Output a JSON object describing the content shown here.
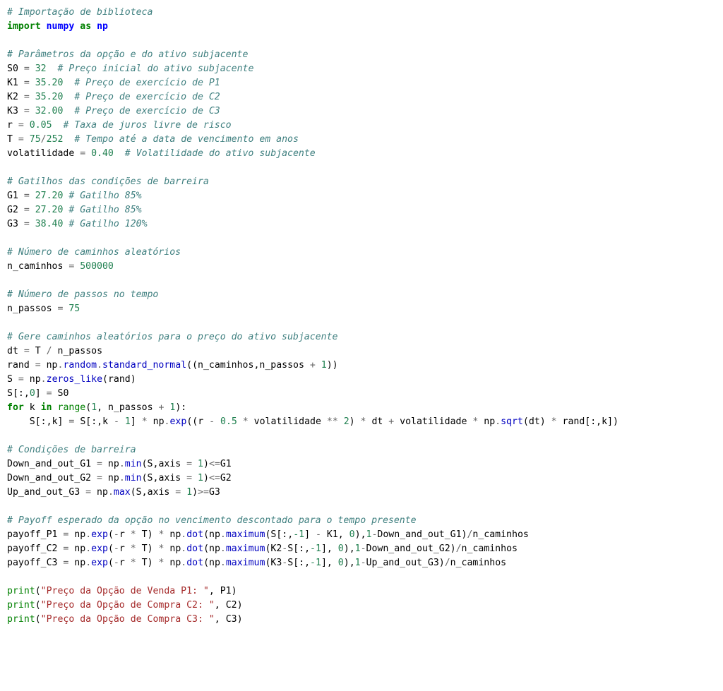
{
  "comments": {
    "c_import": "# Importação de biblioteca",
    "c_params": "# Parâmetros da opção e do ativo subjacente",
    "c_S0": "# Preço inicial do ativo subjacente",
    "c_K1": "# Preço de exercício de P1",
    "c_K2": "# Preço de exercício de C2",
    "c_K3": "# Preço de exercício de C3",
    "c_r": "# Taxa de juros livre de risco",
    "c_T": "# Tempo até a data de vencimento em anos",
    "c_vol": "# Volatilidade do ativo subjacente",
    "c_gat": "# Gatilhos das condições de barreira",
    "c_G1": "# Gatilho 85%",
    "c_G2": "# Gatilho 85%",
    "c_G3": "# Gatilho 120%",
    "c_ncam": "# Número de caminhos aleatórios",
    "c_npas": "# Número de passos no tempo",
    "c_gere": "# Gere caminhos aleatórios para o preço do ativo subjacente",
    "c_cond": "# Condições de barreira",
    "c_payoff": "# Payoff esperado da opção no vencimento descontado para o tempo presente"
  },
  "kw": {
    "import": "import",
    "as": "as",
    "for": "for",
    "in": "in"
  },
  "id": {
    "numpy": "numpy",
    "np": "np",
    "S0": "S0",
    "K1": "K1",
    "K2": "K2",
    "K3": "K3",
    "r": "r",
    "T": "T",
    "vol": "volatilidade",
    "G1": "G1",
    "G2": "G2",
    "G3": "G3",
    "ncam": "n_caminhos",
    "npas": "n_passos",
    "dt": "dt",
    "rand": "rand",
    "S": "S",
    "k": "k",
    "Down_and_out_G1": "Down_and_out_G1",
    "Down_and_out_G2": "Down_and_out_G2",
    "Up_and_out_G3": "Up_and_out_G3",
    "payoff_P1": "payoff_P1",
    "payoff_C2": "payoff_C2",
    "payoff_C3": "payoff_C3",
    "P1": "P1",
    "C2": "C2",
    "C3": "C3",
    "axis": "axis"
  },
  "val": {
    "S0": "32",
    "K1": "35.20",
    "K2": "35.20",
    "K3": "32.00",
    "r": "0.05",
    "T_num": "75",
    "T_den": "252",
    "vol": "0.40",
    "G1": "27.20",
    "G2": "27.20",
    "G3": "38.40",
    "ncam": "500000",
    "npas": "75",
    "zero": "0",
    "one": "1",
    "two": "2",
    "half": "0.5",
    "neg1": "-1"
  },
  "fn": {
    "random": "random",
    "standard_normal": "standard_normal",
    "zeros_like": "zeros_like",
    "exp": "exp",
    "sqrt": "sqrt",
    "min": "min",
    "max": "max",
    "dot": "dot",
    "maximum": "maximum",
    "range": "range",
    "print": "print"
  },
  "str": {
    "p1": "\"Preço da Opção de Venda P1: \"",
    "c2": "\"Preço da Opção de Compra C2: \"",
    "c3": "\"Preço da Opção de Compra C3: \""
  },
  "sym": {
    "eq": " = ",
    "eq_tight": "=",
    "plus": " + ",
    "minus": " - ",
    "star": " * ",
    "star2": " ** ",
    "slash": "/",
    "slash_sp": " / ",
    "lp": "(",
    "rp": ")",
    "lb": "[",
    "rb": "]",
    "comma": ",",
    "comma_sp": ", ",
    "colon": ":",
    "le": "<=",
    "ge": ">=",
    "dot": ".",
    "neg": "-",
    "sp": " ",
    "sp2": "  ",
    "indent": "    "
  }
}
